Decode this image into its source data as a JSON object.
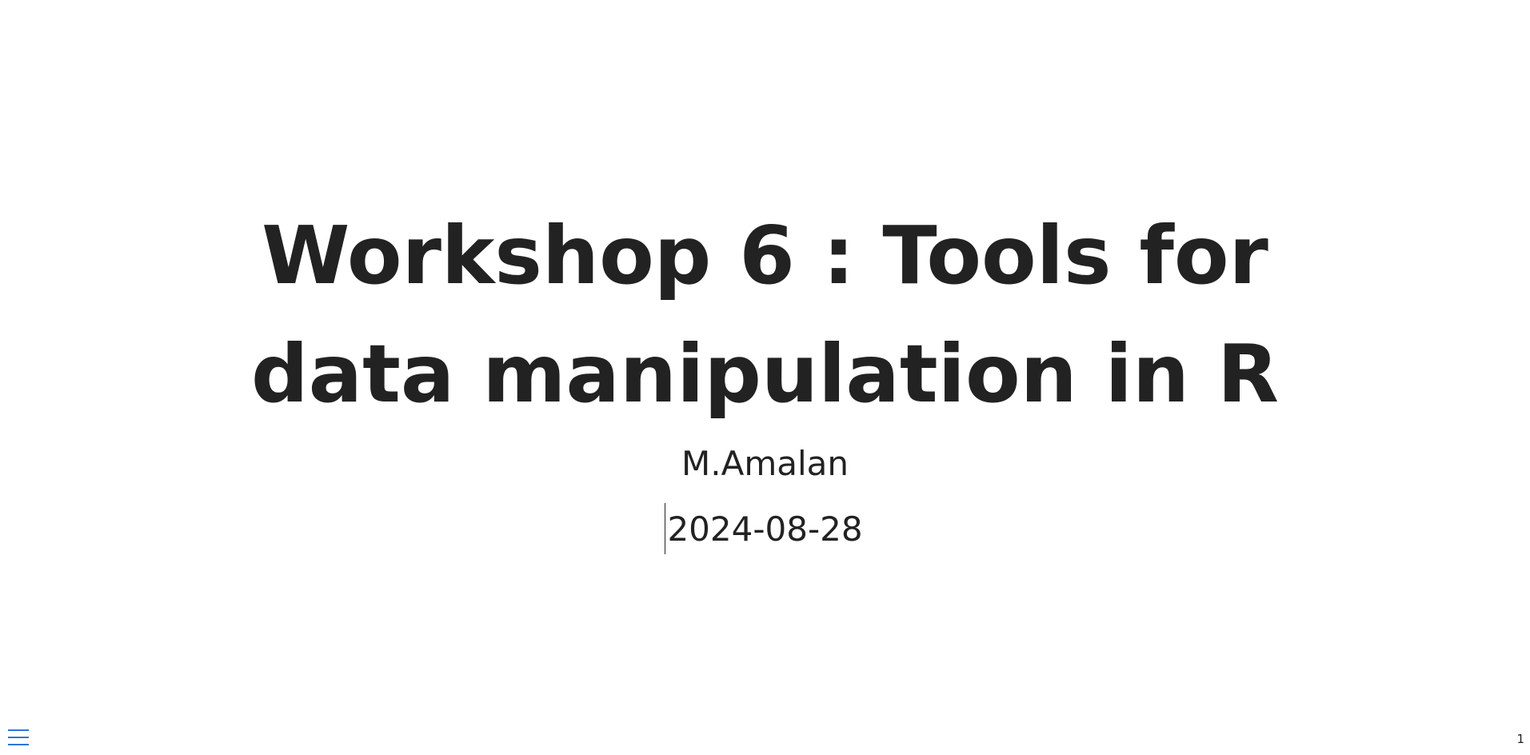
{
  "slide": {
    "title": "Workshop 6 : Tools for data manipulation in R",
    "author": "M.Amalan",
    "date": "2024-08-28",
    "number": "1"
  },
  "controls": {
    "menu_icon": "hamburger-menu-icon",
    "accent_color": "#2a76dd"
  },
  "colors": {
    "text": "#222222",
    "background": "#ffffff"
  }
}
